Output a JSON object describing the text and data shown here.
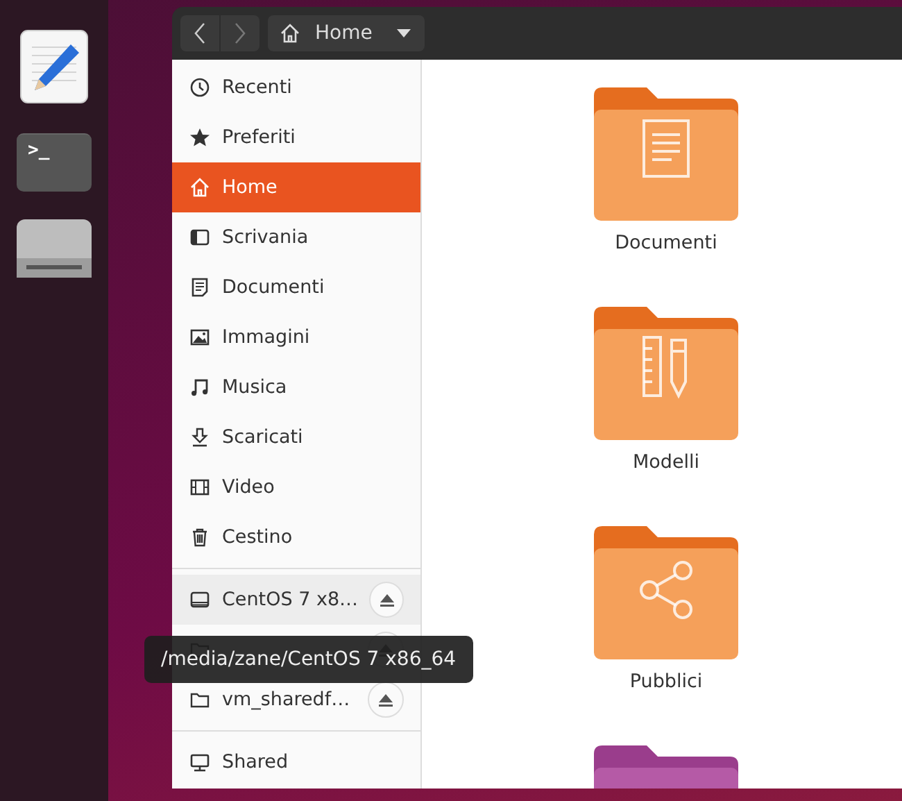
{
  "dock": {
    "apps": [
      {
        "kind": "editor"
      },
      {
        "kind": "terminal",
        "label": ">_"
      },
      {
        "kind": "drive"
      }
    ]
  },
  "header": {
    "back_disabled": false,
    "forward_disabled": true,
    "location": "Home"
  },
  "sidebar": {
    "places": [
      {
        "label": "Recenti",
        "kind": "recent",
        "selected": false
      },
      {
        "label": "Preferiti",
        "kind": "star",
        "selected": false
      },
      {
        "label": "Home",
        "kind": "home",
        "selected": true
      },
      {
        "label": "Scrivania",
        "kind": "desktop",
        "selected": false
      },
      {
        "label": "Documenti",
        "kind": "document",
        "selected": false
      },
      {
        "label": "Immagini",
        "kind": "image",
        "selected": false
      },
      {
        "label": "Musica",
        "kind": "music",
        "selected": false
      },
      {
        "label": "Scaricati",
        "kind": "download",
        "selected": false
      },
      {
        "label": "Video",
        "kind": "video",
        "selected": false
      },
      {
        "label": "Cestino",
        "kind": "trash",
        "selected": false
      }
    ],
    "devices": [
      {
        "label": "CentOS 7 x8…",
        "kind": "drive",
        "eject": true,
        "hovered": true
      },
      {
        "kind": "folder",
        "eject": true,
        "hovered": false
      },
      {
        "label": "vm_sharedf…",
        "kind": "folder",
        "eject": true,
        "hovered": false
      }
    ],
    "network": [
      {
        "label": "Shared",
        "kind": "network",
        "eject": false,
        "hovered": false
      }
    ]
  },
  "tooltip": "/media/zane/CentOS 7 x86_64",
  "folders": [
    {
      "label": "Documenti",
      "kind": "document"
    },
    {
      "label": "Modelli",
      "kind": "template"
    },
    {
      "label": "Pubblici",
      "kind": "share"
    },
    {
      "kind": "partial"
    }
  ]
}
